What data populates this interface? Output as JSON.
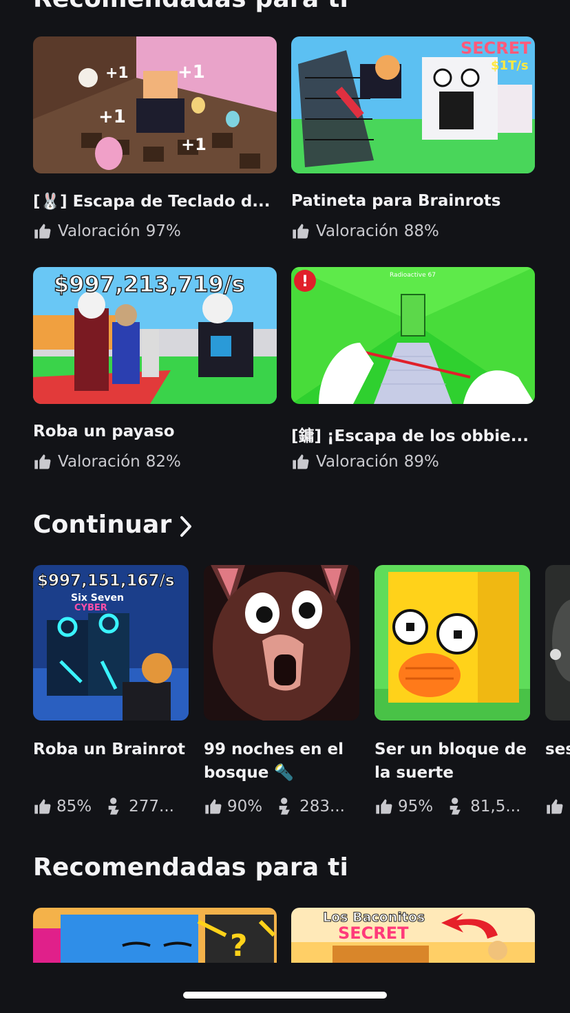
{
  "section_top": {
    "title": "Recomendadas para ti"
  },
  "recommended": [
    {
      "title": "[🐰] Escapa de Teclado d...",
      "rating_label": "Valoración",
      "rating": "97%"
    },
    {
      "title": "Patineta para Brainrots",
      "rating_label": "Valoración",
      "rating": "88%"
    },
    {
      "title": "Roba un payaso",
      "rating_label": "Valoración",
      "rating": "82%",
      "thumb_text": "$997,213,719/s"
    },
    {
      "title": "[鏞] ¡Escapa de los obbie...",
      "rating_label": "Valoración",
      "rating": "89%",
      "thumb_text": "Radioactive 67"
    }
  ],
  "continue_section": {
    "title": "Continuar"
  },
  "continue_items": [
    {
      "title": "Roba un Brainrot",
      "rating": "85%",
      "players": "277...",
      "thumb_text": "$997,151,167/s",
      "thumb_sub": "Six Seven",
      "thumb_sub2": "CYBER"
    },
    {
      "title": "99 noches en el bosque 🔦",
      "rating": "90%",
      "players": "283..."
    },
    {
      "title": "Ser un bloque de la suerte",
      "rating": "95%",
      "players": "81,5..."
    },
    {
      "title": "ses",
      "rating": "",
      "players": ""
    }
  ],
  "section_bottom": {
    "title": "Recomendadas para ti"
  },
  "recommended_bottom": [
    {
      "thumb_text": ""
    },
    {
      "thumb_text": "Los Baconitos",
      "thumb_sub": "SECRET"
    }
  ],
  "badges": {
    "secret": "SECRET",
    "secret_rate": "$1T/s"
  },
  "icons": {
    "rating": "thumbs-up-icon",
    "players": "players-icon",
    "more": "chevron-right-icon"
  },
  "colors": {
    "background": "#121317",
    "text": "#f2f2f4",
    "muted": "#c9c9ce"
  }
}
